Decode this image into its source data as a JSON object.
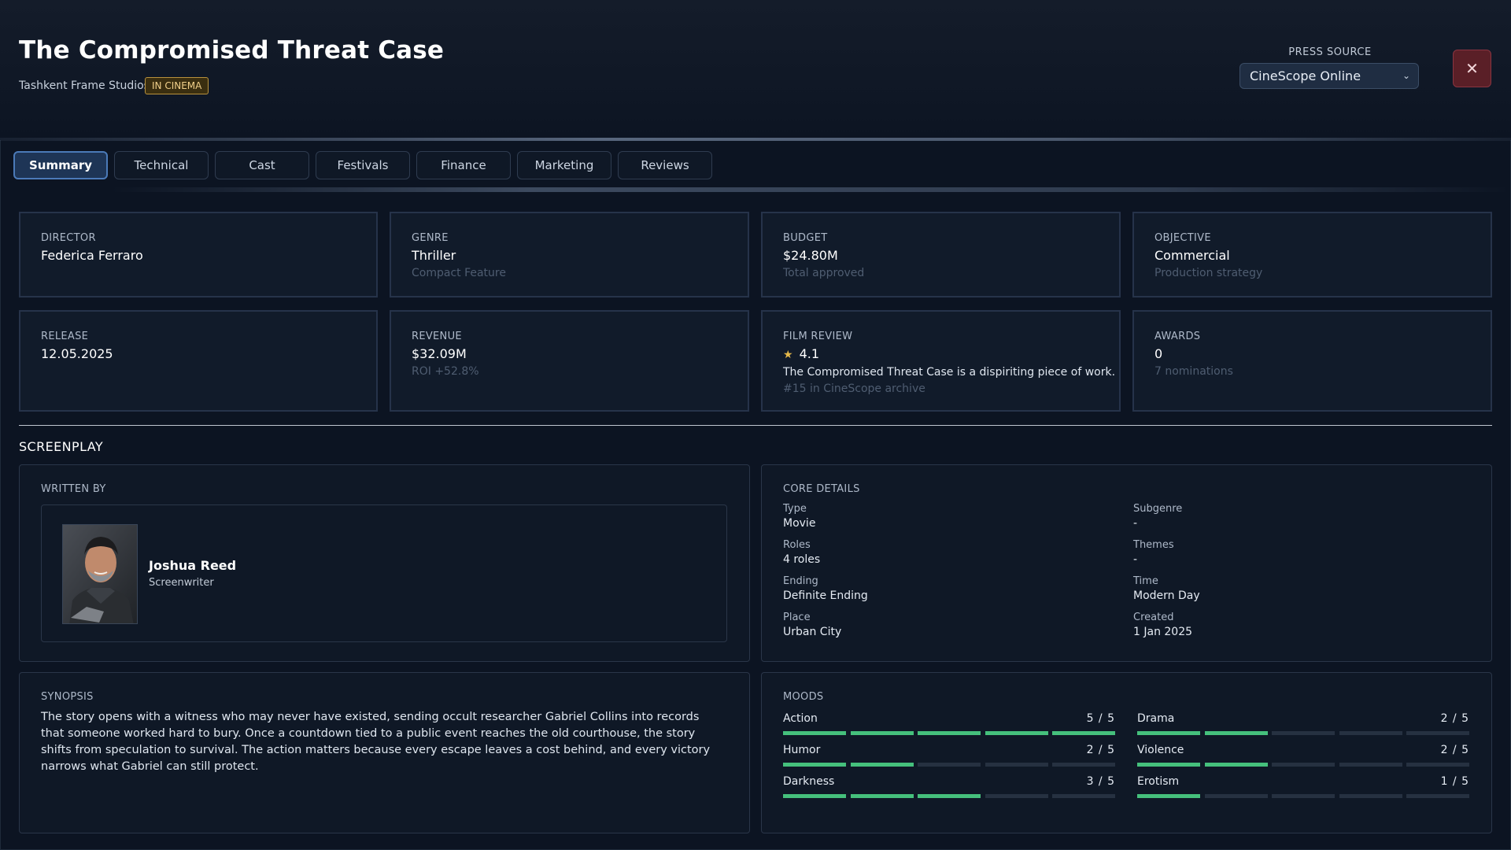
{
  "header": {
    "title": "The Compromised Threat Case",
    "studio": "Tashkent Frame Studios",
    "status_badge": "IN CINEMA",
    "press_source_label": "PRESS SOURCE",
    "press_source_value": "CineScope Online",
    "close_icon": "close-icon"
  },
  "tabs": [
    {
      "label": "Summary",
      "active": true
    },
    {
      "label": "Technical",
      "active": false
    },
    {
      "label": "Cast",
      "active": false
    },
    {
      "label": "Festivals",
      "active": false
    },
    {
      "label": "Finance",
      "active": false
    },
    {
      "label": "Marketing",
      "active": false
    },
    {
      "label": "Reviews",
      "active": false
    }
  ],
  "cards": {
    "director": {
      "label": "DIRECTOR",
      "value": "Federica Ferraro"
    },
    "genre": {
      "label": "GENRE",
      "value": "Thriller",
      "sub": "Compact Feature"
    },
    "budget": {
      "label": "BUDGET",
      "value": "$24.80M",
      "sub": "Total approved"
    },
    "objective": {
      "label": "OBJECTIVE",
      "value": "Commercial",
      "sub": "Production strategy"
    },
    "release": {
      "label": "RELEASE",
      "value": "12.05.2025"
    },
    "revenue": {
      "label": "REVENUE",
      "value": "$32.09M",
      "sub": "ROI +52.8%"
    },
    "film_review": {
      "label": "FILM REVIEW",
      "rating": "4.1",
      "text": "The Compromised Threat Case is a dispiriting piece of work.",
      "sub": "#15 in CineScope archive"
    },
    "awards": {
      "label": "AWARDS",
      "value": "0",
      "sub": "7 nominations"
    }
  },
  "screenplay": {
    "section_title": "SCREENPLAY",
    "written_by_label": "WRITTEN BY",
    "writer": {
      "name": "Joshua Reed",
      "role": "Screenwriter"
    },
    "core_details_label": "CORE DETAILS",
    "core_details": {
      "type": {
        "k": "Type",
        "v": "Movie"
      },
      "subgenre": {
        "k": "Subgenre",
        "v": "-"
      },
      "roles": {
        "k": "Roles",
        "v": "4 roles"
      },
      "themes": {
        "k": "Themes",
        "v": "-"
      },
      "ending": {
        "k": "Ending",
        "v": "Definite Ending"
      },
      "time": {
        "k": "Time",
        "v": "Modern Day"
      },
      "place": {
        "k": "Place",
        "v": "Urban City"
      },
      "created": {
        "k": "Created",
        "v": "1 Jan 2025"
      }
    },
    "synopsis_label": "SYNOPSIS",
    "synopsis": "The story opens with a witness who may never have existed, sending occult researcher Gabriel Collins into records that someone worked hard to bury. Once a countdown tied to a public event reaches the old courthouse, the story shifts from speculation to survival. The action matters because every escape leaves a cost behind, and every victory narrows what Gabriel can still protect.",
    "moods_label": "MOODS",
    "moods": [
      {
        "name": "Action",
        "value": 5,
        "display": "5 / 5"
      },
      {
        "name": "Drama",
        "value": 2,
        "display": "2 / 5"
      },
      {
        "name": "Humor",
        "value": 2,
        "display": "2 / 5"
      },
      {
        "name": "Violence",
        "value": 2,
        "display": "2 / 5"
      },
      {
        "name": "Darkness",
        "value": 3,
        "display": "3 / 5"
      },
      {
        "name": "Erotism",
        "value": 1,
        "display": "1 / 5"
      }
    ],
    "mood_max": 5
  },
  "colors": {
    "accent": "#4b7ab8",
    "mood_fill": "#45c07c",
    "star": "#e6b94a",
    "badge": "#b9923c",
    "close": "#5a1f27"
  }
}
